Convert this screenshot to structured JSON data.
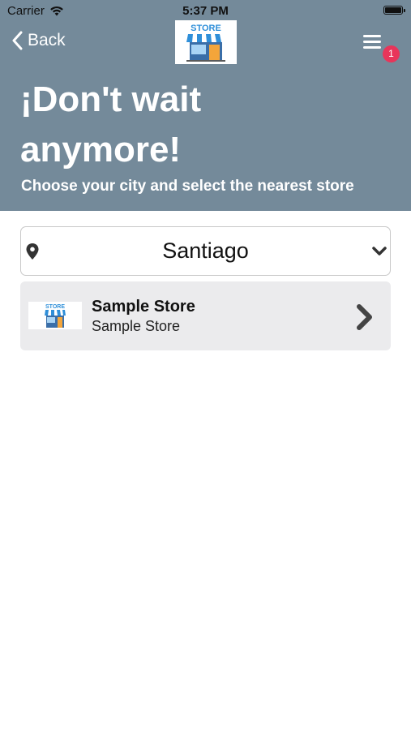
{
  "status_bar": {
    "carrier": "Carrier",
    "time": "5:37 PM"
  },
  "nav": {
    "back_label": "Back",
    "logo_text": "STORE",
    "menu_badge_count": "1"
  },
  "hero": {
    "headline": "¡Don't wait anymore!",
    "subtitle": "Choose your city and select the nearest store"
  },
  "city_select": {
    "value": "Santiago"
  },
  "stores": [
    {
      "name": "Sample Store",
      "subtitle": "Sample Store",
      "logo_text": "STORE"
    }
  ],
  "colors": {
    "header_bg": "#748a9a",
    "badge": "#e8355a",
    "card_bg": "#ebebed",
    "store_awning": "#2f8fd9",
    "store_door": "#f4a53a"
  }
}
